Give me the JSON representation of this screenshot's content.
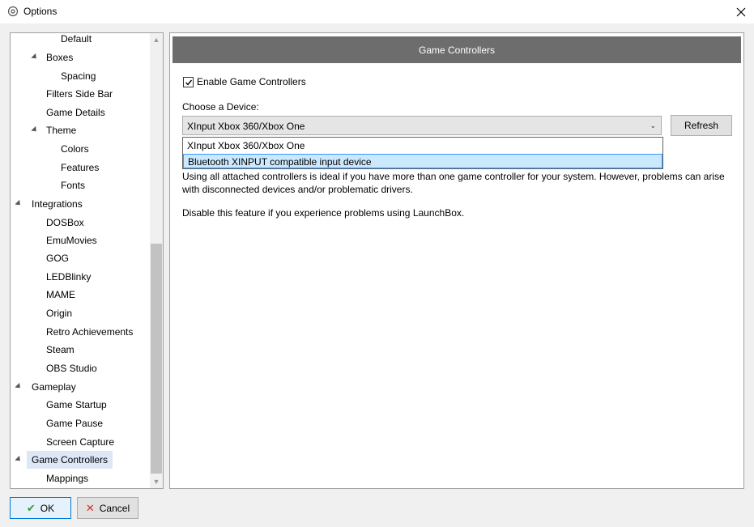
{
  "window": {
    "title": "Options",
    "close_icon": "close-icon"
  },
  "tree": {
    "items": [
      {
        "label": "Default"
      },
      {
        "label": "Boxes"
      },
      {
        "label": "Spacing"
      },
      {
        "label": "Filters Side Bar"
      },
      {
        "label": "Game Details"
      },
      {
        "label": "Theme"
      },
      {
        "label": "Colors"
      },
      {
        "label": "Features"
      },
      {
        "label": "Fonts"
      },
      {
        "label": "Integrations"
      },
      {
        "label": "DOSBox"
      },
      {
        "label": "EmuMovies"
      },
      {
        "label": "GOG"
      },
      {
        "label": "LEDBlinky"
      },
      {
        "label": "MAME"
      },
      {
        "label": "Origin"
      },
      {
        "label": "Retro Achievements"
      },
      {
        "label": "Steam"
      },
      {
        "label": "OBS Studio"
      },
      {
        "label": "Gameplay"
      },
      {
        "label": "Game Startup"
      },
      {
        "label": "Game Pause"
      },
      {
        "label": "Screen Capture"
      },
      {
        "label": "Game Controllers"
      },
      {
        "label": "Mappings"
      }
    ]
  },
  "panel": {
    "header": "Game Controllers",
    "enable_checkbox": {
      "label": "Enable Game Controllers",
      "checked": true
    },
    "choose_label": "Choose a Device:",
    "combo": {
      "selected": "XInput Xbox 360/Xbox One"
    },
    "dropdown_options": [
      "XInput Xbox 360/Xbox One",
      "Bluetooth XINPUT compatible input device"
    ],
    "refresh_label": "Refresh",
    "description": "Using all attached controllers is ideal if you have more than one game controller for your system. However, problems can arise with disconnected devices and/or problematic drivers.",
    "description2": "Disable this feature if you experience problems using LaunchBox."
  },
  "footer": {
    "ok_label": "OK",
    "cancel_label": "Cancel"
  },
  "colors": {
    "header_bg": "#6d6d6d",
    "selection": "#dde7f6",
    "highlight": "#cce8ff",
    "accent": "#0078d7"
  }
}
